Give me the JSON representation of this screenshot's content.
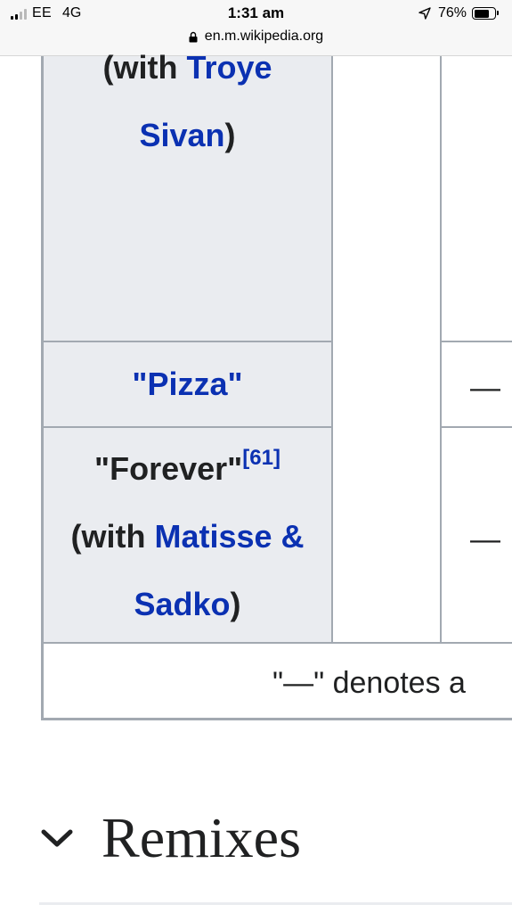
{
  "status_bar": {
    "carrier": "EE",
    "network": "4G",
    "time": "1:31 am",
    "battery_percent": "76%",
    "battery_level": 0.76,
    "signal_bars_active": 2,
    "url": "en.m.wikipedia.org"
  },
  "table": {
    "rows": [
      {
        "parts": [
          {
            "text": "(with "
          },
          {
            "text": "Troye",
            "link": true
          },
          {
            "text": "Sivan",
            "link": true,
            "newline": true
          },
          {
            "text": ")"
          }
        ]
      },
      {
        "title": "\"Pizza\"",
        "dash": "—"
      },
      {
        "title_open": "\"Forever\"",
        "ref": "[61]",
        "with_prefix": "(with ",
        "featured_line1": "Matisse &",
        "featured_line2": "Sadko",
        "with_suffix": ")",
        "dash": "—"
      }
    ],
    "footnote": "\"—\" denotes a"
  },
  "section": {
    "title": "Remixes",
    "toggle_icon": "chevron-down-icon"
  },
  "colors": {
    "link": "#0b31b2",
    "header_cell_bg": "#eaecf0",
    "border": "#a2a9b1",
    "text": "#202122"
  }
}
